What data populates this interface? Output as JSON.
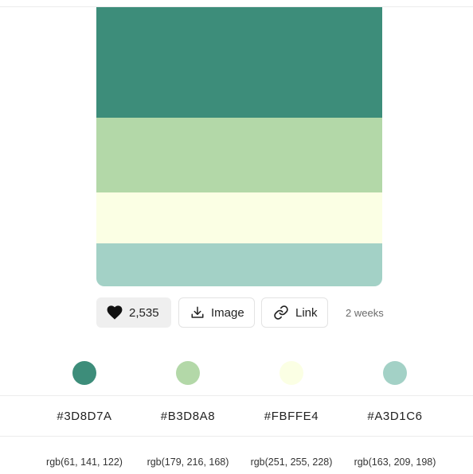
{
  "palette": {
    "colors": [
      {
        "hex": "#3D8D7A",
        "rgb": "rgb(61, 141, 122)",
        "fill": "#3D8D7A",
        "band_height": 139
      },
      {
        "hex": "#B3D8A8",
        "rgb": "rgb(179, 216, 168)",
        "fill": "#B3D8A8",
        "band_height": 94
      },
      {
        "hex": "#FBFFE4",
        "rgb": "rgb(251, 255, 228)",
        "fill": "#FBFFE4",
        "band_height": 64
      },
      {
        "hex": "#A3D1C6",
        "rgb": "rgb(163, 209, 198)",
        "fill": "#A3D1C6",
        "band_height": 54
      }
    ]
  },
  "actions": {
    "like_count": "2,535",
    "image_label": "Image",
    "link_label": "Link",
    "age": "2 weeks"
  },
  "icons": {
    "like": "heart-icon",
    "image": "download-icon",
    "link": "link-icon"
  }
}
